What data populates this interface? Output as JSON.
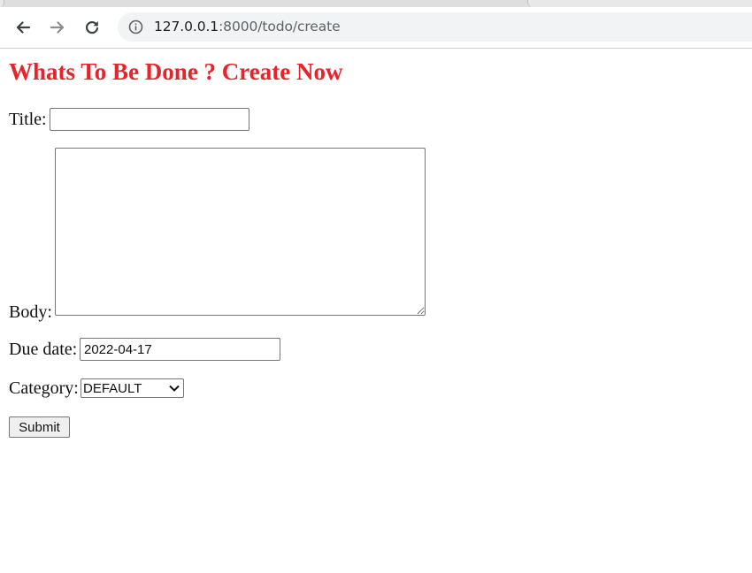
{
  "browser": {
    "url_host": "127.0.0.1",
    "url_path": ":8000/todo/create"
  },
  "page": {
    "heading": "Whats To Be Done ? Create Now",
    "heading_color": "#e8232a"
  },
  "form": {
    "title_label": "Title:",
    "title_value": "",
    "body_label": "Body:",
    "body_value": "",
    "due_label": "Due date:",
    "due_value": "2022-04-17",
    "category_label": "Category:",
    "category_selected": "DEFAULT",
    "submit_label": "Submit"
  }
}
